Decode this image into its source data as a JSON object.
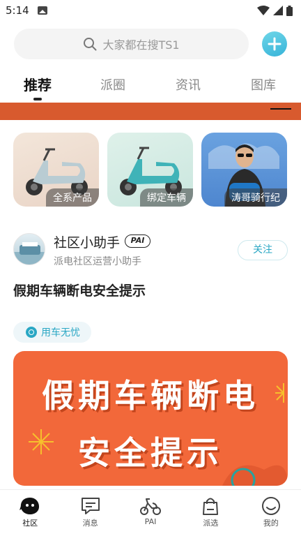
{
  "status_bar": {
    "time": "5:14"
  },
  "search": {
    "placeholder": "大家都在搜TS1"
  },
  "tabs": [
    {
      "label": "推荐",
      "active": true
    },
    {
      "label": "派圈",
      "active": false
    },
    {
      "label": "资讯",
      "active": false
    },
    {
      "label": "图库",
      "active": false
    }
  ],
  "categories": [
    {
      "label": "全系产品"
    },
    {
      "label": "绑定车辆"
    },
    {
      "label": "涛哥骑行纪"
    }
  ],
  "post": {
    "author": "社区小助手",
    "badge": "PAI",
    "author_subtitle": "派电社区运营小助手",
    "follow_label": "关注",
    "title": "假期车辆断电安全提示",
    "tag": "用车无忧",
    "image_text": [
      "假期车辆断电",
      "安全提示"
    ]
  },
  "bottom_nav": [
    {
      "label": "社区",
      "icon": "community-icon",
      "active": true
    },
    {
      "label": "消息",
      "icon": "message-icon",
      "active": false
    },
    {
      "label": "PAI",
      "icon": "scooter-icon",
      "active": false
    },
    {
      "label": "派选",
      "icon": "shopping-bag-icon",
      "active": false
    },
    {
      "label": "我的",
      "icon": "smile-profile-icon",
      "active": false
    }
  ],
  "colors": {
    "accent": "#2aa7c4",
    "banner": "#d85a2e",
    "post_image": "#f2683a"
  }
}
